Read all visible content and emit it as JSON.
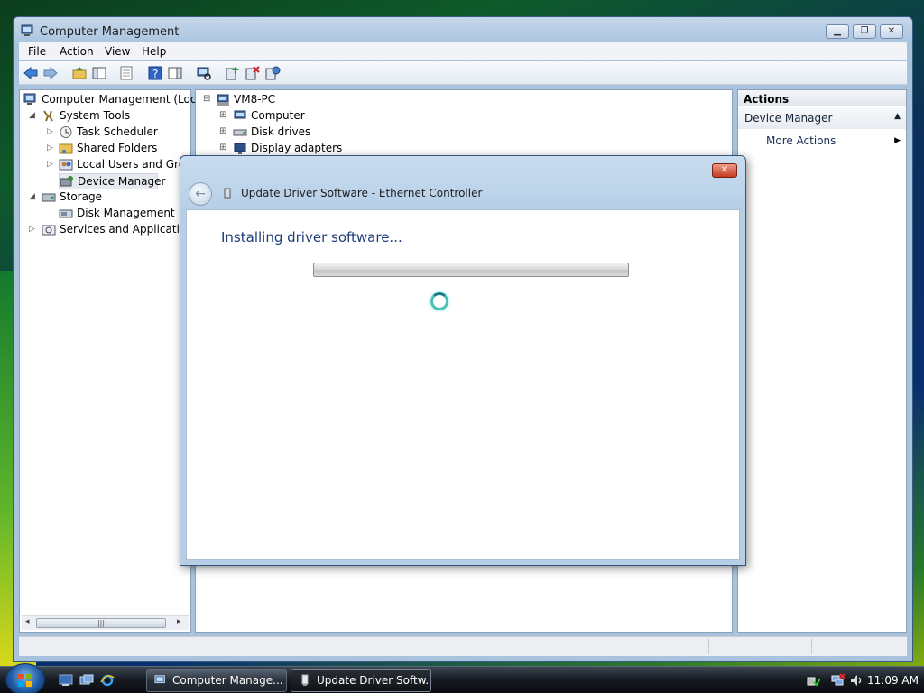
{
  "window": {
    "title": "Computer Management",
    "controls": [
      "minimize",
      "maximize",
      "close"
    ]
  },
  "menu": [
    "File",
    "Action",
    "View",
    "Help"
  ],
  "toolbar_icons": [
    "back-arrow-icon",
    "forward-arrow-icon",
    "up-folder-icon",
    "show-hide-tree-icon",
    "properties-icon",
    "help-icon",
    "show-hide-action-pane-icon",
    "scan-hardware-icon",
    "update-driver-icon",
    "uninstall-icon",
    "disable-icon"
  ],
  "tree": {
    "root": "Computer Management (Local",
    "system_tools": "System Tools",
    "task_scheduler": "Task Scheduler",
    "shared_folders": "Shared Folders",
    "local_users": "Local Users and Group",
    "device_manager": "Device Manager",
    "storage": "Storage",
    "disk_management": "Disk Management",
    "services": "Services and Applications"
  },
  "devices": {
    "root": "VM8-PC",
    "items": [
      "Computer",
      "Disk drives",
      "Display adapters"
    ]
  },
  "actions": {
    "header": "Actions",
    "section": "Device Manager",
    "more": "More Actions"
  },
  "dialog": {
    "title": "Update Driver Software - Ethernet Controller",
    "heading": "Installing driver software...",
    "progress_state": "indeterminate"
  },
  "taskbar": {
    "buttons": [
      {
        "label": "Computer Manage...",
        "active": false
      },
      {
        "label": "Update Driver Softw...",
        "active": true
      }
    ],
    "clock": "11:09 AM"
  },
  "colors": {
    "accent": "#1f3c78",
    "window_frame": "#a9c3de",
    "close_red": "#c43b20"
  }
}
